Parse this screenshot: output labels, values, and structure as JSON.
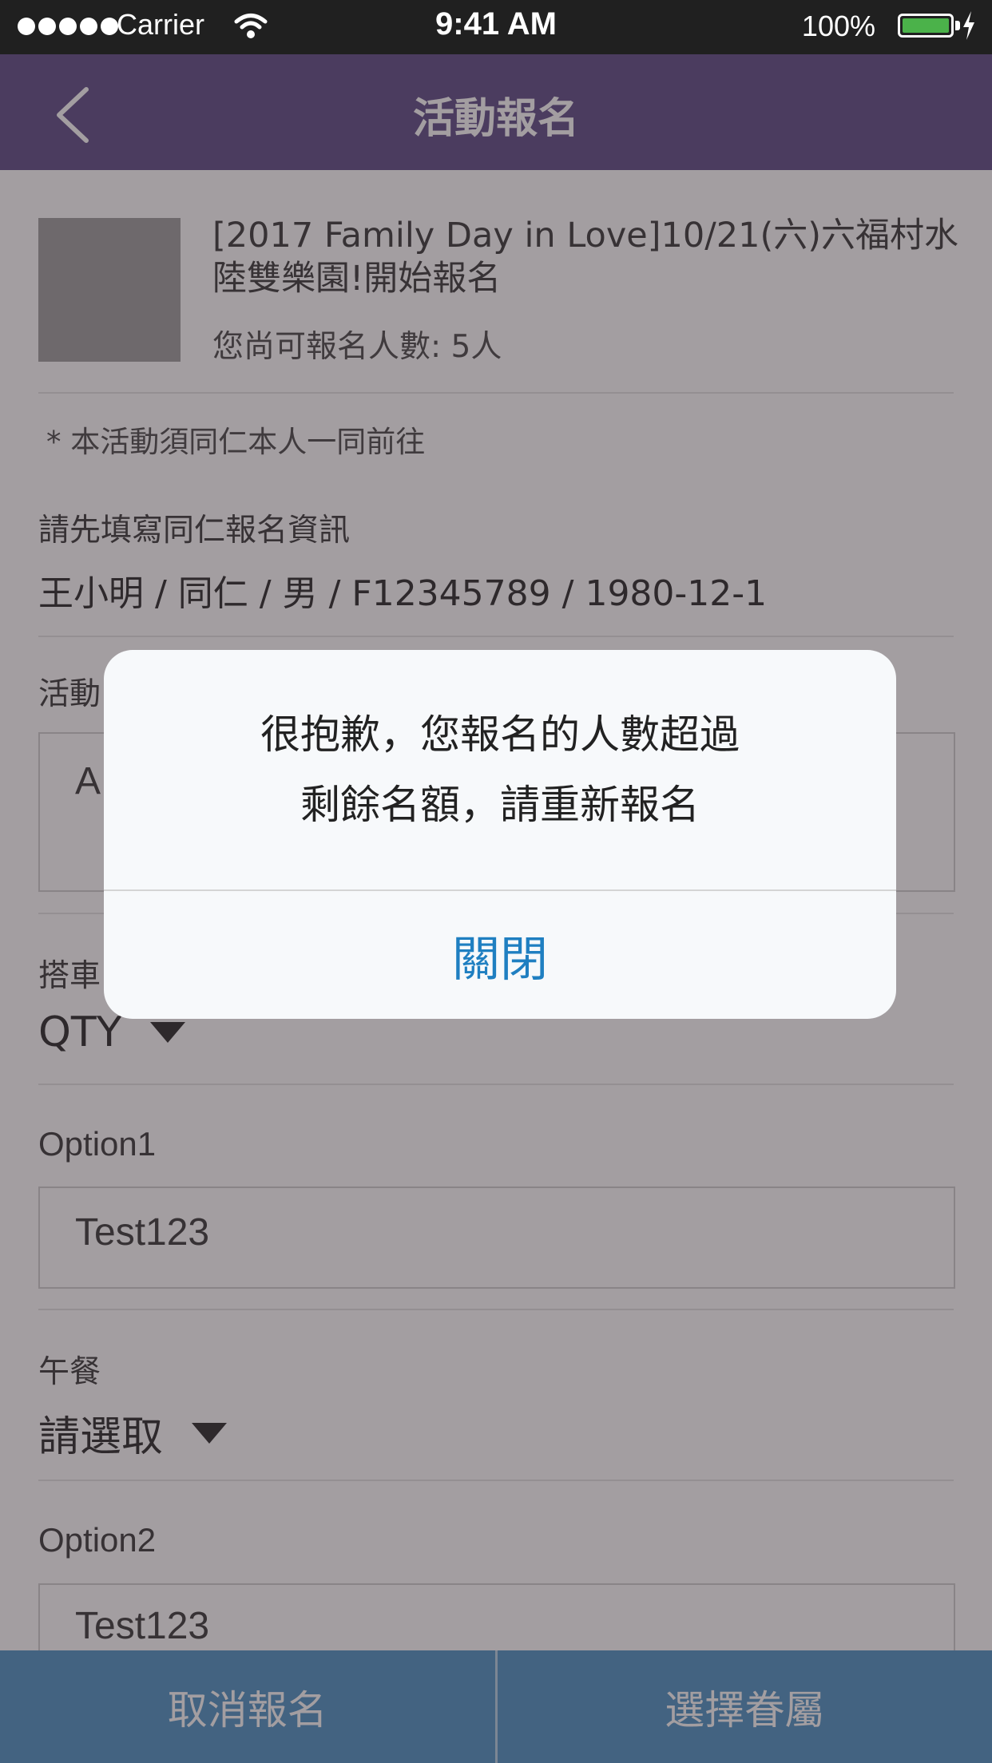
{
  "status_bar": {
    "carrier": "Carrier",
    "time": "9:41 AM",
    "battery": "100%"
  },
  "nav": {
    "title": "活動報名",
    "back_icon": "chevron-left-icon"
  },
  "event": {
    "title": "[2017 Family Day in Love]10/21(六)六福村水陸雙樂園!開始報名",
    "remaining": "您尚可報名人數: 5人",
    "note": "* 本活動須同仁本人一同前往"
  },
  "form": {
    "colleague_label": "請先填寫同仁報名資訊",
    "colleague_info": "王小明 / 同仁 / 男 / F12345789 / 1980-12-1",
    "activity_label": "活動",
    "activity_value": "A",
    "bus_label": "搭車",
    "bus_select": "QTY",
    "option1_label": "Option1",
    "option1_value": "Test123",
    "lunch_label": "午餐",
    "lunch_select": "請選取",
    "option2_label": "Option2",
    "option2_value": "Test123"
  },
  "bottom": {
    "cancel": "取消報名",
    "choose": "選擇眷屬"
  },
  "dialog": {
    "message_line1": "很抱歉，您報名的人數超過",
    "message_line2": "剩餘名額，請重新報名",
    "close": "關閉"
  },
  "colors": {
    "nav": "#5a4683",
    "bottom": "#4a90c2",
    "dialog_button": "#1f7fc1"
  }
}
